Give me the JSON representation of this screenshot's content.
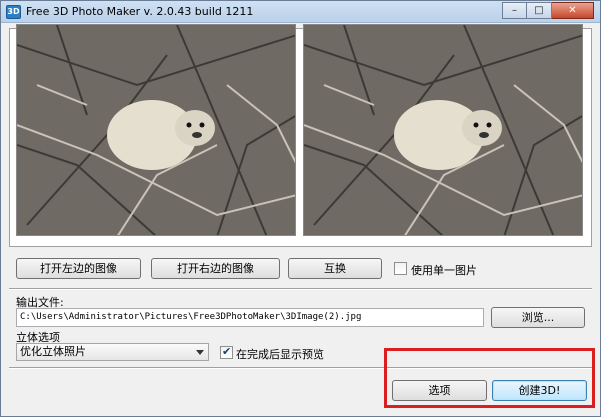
{
  "window": {
    "title": "Free 3D Photo Maker  v. 2.0.43 build 1211",
    "app_icon_text": "3D",
    "controls": {
      "minimize": "–",
      "maximize": "□",
      "close": "✕"
    }
  },
  "preview": {
    "left_image_alt": "left-image-preview",
    "right_image_alt": "right-image-preview"
  },
  "actions": {
    "open_left": "打开左边的图像",
    "open_right": "打开右边的图像",
    "swap": "互换",
    "single_image_label": "使用单一图片",
    "single_image_checked": false
  },
  "output": {
    "label": "输出文件:",
    "path": "C:\\Users\\Administrator\\Pictures\\Free3DPhotoMaker\\3DImage(2).jpg",
    "browse": "浏览..."
  },
  "stereo": {
    "label": "立体选项",
    "selected": "优化立体照片",
    "preview_after_label": "在完成后显示预览",
    "preview_after_checked": true
  },
  "footer": {
    "options": "选项",
    "create": "创建3D!"
  },
  "colors": {
    "highlight": "#d9201f",
    "accent": "#3c7fb1"
  }
}
